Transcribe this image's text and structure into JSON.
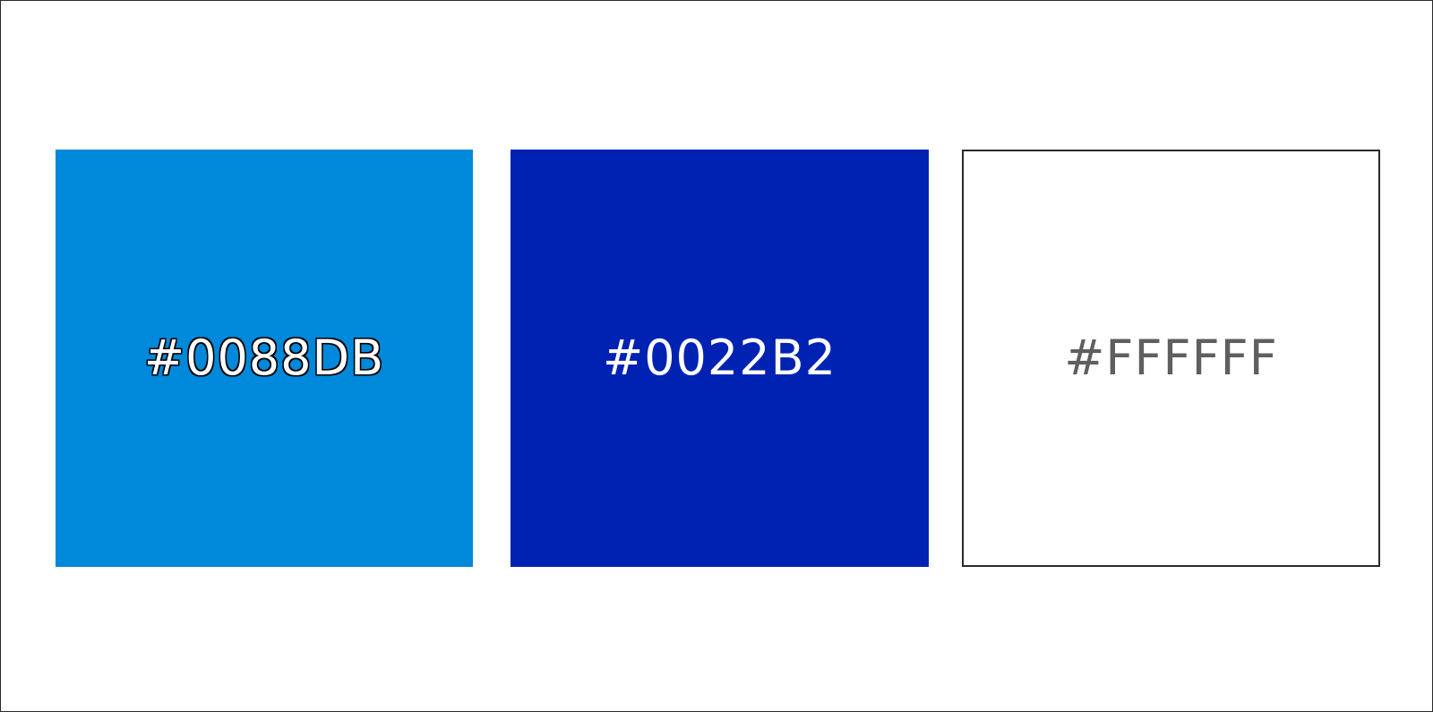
{
  "swatches": [
    {
      "hex": "#0088DB",
      "fill": "#0088DB",
      "text_color": "#FFFFFF"
    },
    {
      "hex": "#0022B2",
      "fill": "#0022B2",
      "text_color": "#FFFFFF"
    },
    {
      "hex": "#FFFFFF",
      "fill": "#FFFFFF",
      "text_color": "#5F5F5F"
    }
  ]
}
